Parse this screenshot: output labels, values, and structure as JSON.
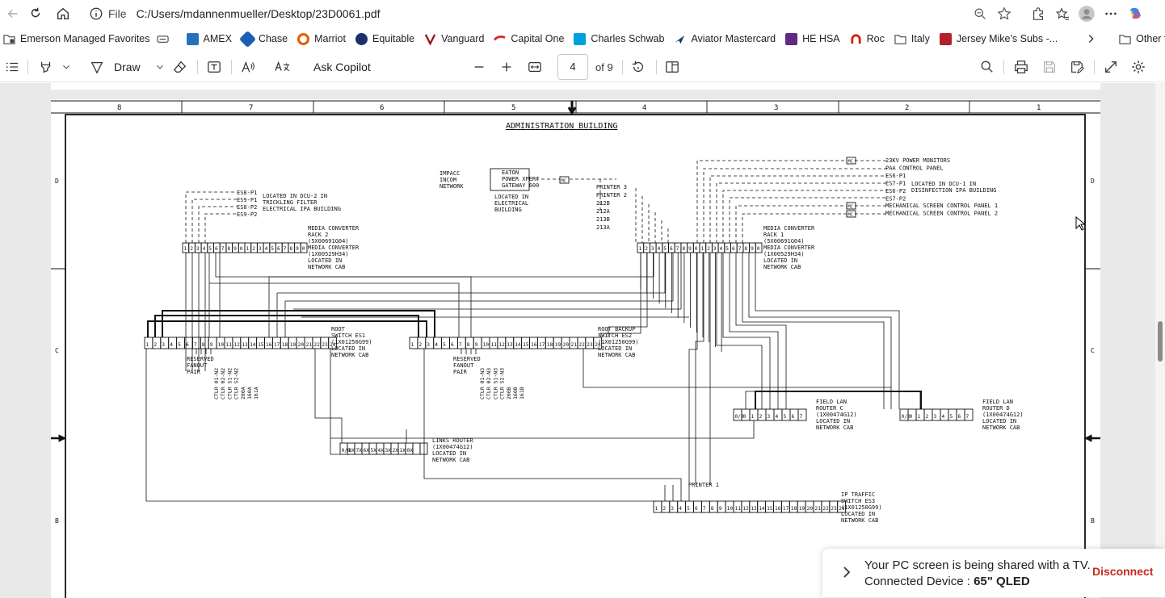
{
  "browser": {
    "scheme": "File",
    "url": "C:/Users/mdannenmueller/Desktop/23D0061.pdf"
  },
  "favorites": {
    "items": [
      {
        "label": "Emerson Managed Favorites",
        "icon": "folder-icon",
        "color": "#444444"
      },
      {
        "label": "",
        "icon": "reading-icon",
        "color": "#444444"
      },
      {
        "label": "AMEX",
        "icon": "amex-icon",
        "color": "#2671b9"
      },
      {
        "label": "Chase",
        "icon": "chase-icon",
        "color": "#1a5fb4"
      },
      {
        "label": "Marriot",
        "icon": "marriott-icon",
        "color": "#e65c00"
      },
      {
        "label": "Equitable",
        "icon": "equitable-icon",
        "color": "#1b2f6b"
      },
      {
        "label": "Vanguard",
        "icon": "vanguard-icon",
        "color": "#96151d"
      },
      {
        "label": "Capital One",
        "icon": "capital-one-icon",
        "color": "#d03027"
      },
      {
        "label": "Charles Schwab",
        "icon": "schwab-icon",
        "color": "#00a0df"
      },
      {
        "label": "Aviator Mastercard",
        "icon": "aviator-icon",
        "color": "#1b3a6b"
      },
      {
        "label": "HE HSA",
        "icon": "hsa-icon",
        "color": "#5e2a84"
      },
      {
        "label": "Roc",
        "icon": "roc-icon",
        "color": "#d81e05"
      },
      {
        "label": "Italy",
        "icon": "folder-icon",
        "color": "#444444"
      },
      {
        "label": "Jersey Mike's Subs -...",
        "icon": "jersey-mikes-icon",
        "color": "#b3202b"
      }
    ],
    "other": "Other favorites"
  },
  "pdf_toolbar": {
    "draw_label": "Draw",
    "copilot_label": "Ask Copilot",
    "page_number": "4",
    "page_total": "of 9"
  },
  "drawing": {
    "title": "ADMINISTRATION BUILDING",
    "columns": [
      "8",
      "7",
      "6",
      "5",
      "4",
      "3",
      "2",
      "1"
    ],
    "rows": [
      "D",
      "C",
      "B"
    ],
    "es8_labels": [
      "ES8-P1",
      "ES9-P1",
      "ES8-P2",
      "ES9-P2"
    ],
    "es8_note": [
      "LOCATED IN DCU-2 IN",
      "TRICKLING FILTER",
      "ELECTRICAL IPA BUILDING"
    ],
    "mc_rack2": [
      "MEDIA CONVERTER",
      "RACK 2",
      "(5X00691G04)",
      "MEDIA CONVERTER",
      "(1X00529H34)",
      "LOCATED IN",
      "NETWORK CAB"
    ],
    "impacc": [
      "IMPACC",
      "INCOM",
      "NETWORK"
    ],
    "eaton": [
      "EATON",
      "POWER XPERT",
      "GATEWAY 600"
    ],
    "eaton_note": [
      "LOCATED IN",
      "ELECTRICAL",
      "BUILDING"
    ],
    "printers": [
      "PRINTER 3",
      "PRINTER 2",
      "212B",
      "212A",
      "213B",
      "213A"
    ],
    "right_feeds": [
      "23KV POWER MONITORS",
      "PAA CONTROL PANEL",
      "ES6-P1",
      "ES7-P1",
      "ES6-P2",
      "ES7-P2",
      "MECHANICAL SCREEN CONTROL PANEL 1",
      "MECHANICAL SCREEN CONTROL PANEL 2"
    ],
    "es6_note": [
      "LOCATED IN DCU-1 IN",
      "DISINFECTION IPA BUILDING"
    ],
    "mc_rack1": [
      "MEDIA CONVERTER",
      "RACK 1",
      "(5X00691G04)",
      "MEDIA CONVERTER",
      "(1X00529H34)",
      "LOCATED IN",
      "NETWORK CAB"
    ],
    "root_switch": [
      "ROOT",
      "SWITCH ES1",
      "(1X01250G99)",
      "LOCATED IN",
      "NETWORK CAB"
    ],
    "root_backup": [
      "ROOT BACKUP",
      "SWITCH ES2",
      "(1X01250G99)",
      "LOCATED IN",
      "NETWORK CAB"
    ],
    "reserved": [
      "RESERVED",
      "FANOUT",
      "PAIR"
    ],
    "es1_vlabels": [
      "CTLR 01-N2",
      "CTLR 02-N2",
      "CTLR S1-N2",
      "CTLR S2-N2",
      "200A",
      "160A",
      "161A"
    ],
    "es2_vlabels": [
      "CTLR 01-N3",
      "CTLR 02-N3",
      "CTLR S1-N3",
      "CTLR S2-N3",
      "200B",
      "160B",
      "161B"
    ],
    "router_c": [
      "FIELD LAN",
      "ROUTER C",
      "(1X00474G12)",
      "LOCATED IN",
      "NETWORK CAB"
    ],
    "router_d": [
      "FIELD LAN",
      "ROUTER D",
      "(1X00474G12)",
      "LOCATED IN",
      "NETWORK CAB"
    ],
    "links_router": [
      "LINKS ROUTER",
      "(1X00474G12)",
      "LOCATED IN",
      "NETWORK CAB"
    ],
    "printer1": "PRINTER 1",
    "ip_switch": [
      "IP TRAFFIC",
      "SWITCH ES3",
      "(1X01250G99)",
      "LOCATED IN",
      "NETWORK CAB"
    ],
    "mc_tag": "MC"
  },
  "toast": {
    "line1": "Your PC screen is being shared with a TV.",
    "line2_prefix": "Connected Device : ",
    "device": "65\" QLED",
    "disconnect": "Disconnect"
  }
}
